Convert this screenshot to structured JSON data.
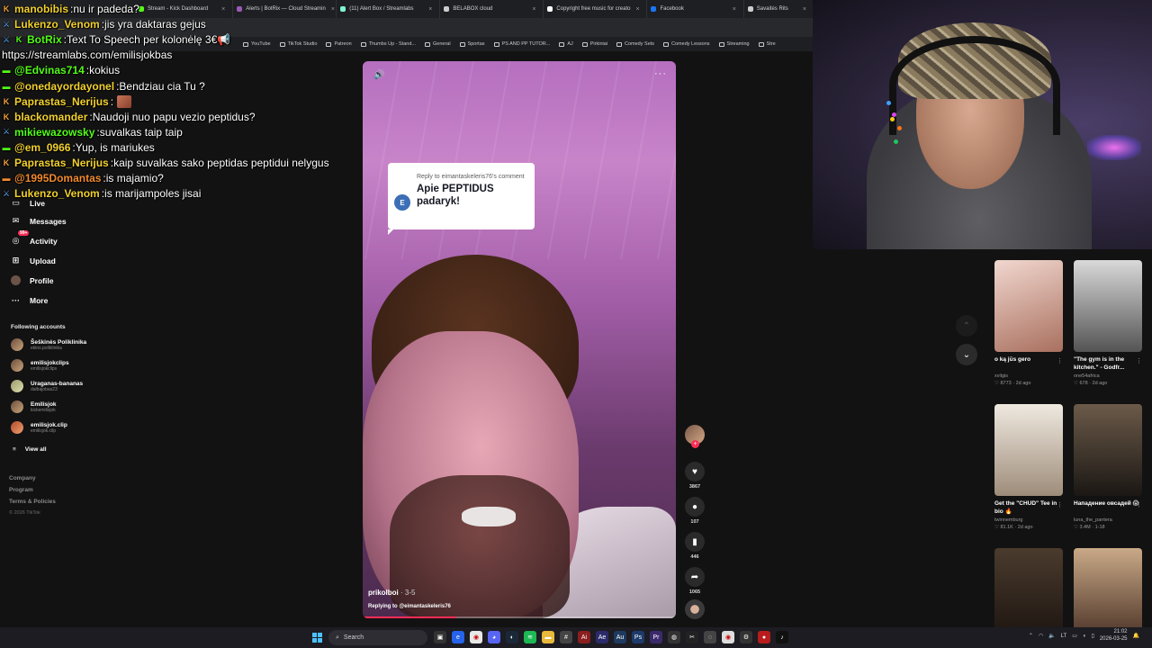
{
  "browser": {
    "tabs": [
      {
        "label": "Stream - Kick Dashboard",
        "color": "#53fc18"
      },
      {
        "label": "Alerts | BotRix — Cloud Streamin",
        "color": "#9b59b6"
      },
      {
        "label": "(11) Alert Box / Streamlabs",
        "color": "#80f5d2"
      },
      {
        "label": "BELABOX cloud",
        "color": "#cccccc"
      },
      {
        "label": "Copyright free music for creato",
        "color": "#ffffff"
      },
      {
        "label": "Facebook",
        "color": "#1877f2"
      },
      {
        "label": "Savaitės Rits",
        "color": "#cccccc"
      }
    ],
    "bookmarks": [
      "YouTube",
      "TikTok Studio",
      "Patreon",
      "Thumbs Up - Stand...",
      "General",
      "Sportas",
      "PS AND PP TUTOR...",
      "AJ",
      "Pirkiniai",
      "Comedy Sets",
      "Comedy Lessons",
      "Streaming",
      "Stre"
    ]
  },
  "chat": [
    {
      "badge": "kick",
      "user": "manobibis",
      "user_color": "#f2d12e",
      "message": "nu ir padeda?"
    },
    {
      "badge": "mod",
      "user": "Lukenzo_Venom",
      "user_color": "#f2d12e",
      "message": "jis yra daktaras gejus"
    },
    {
      "badge": "mod-kick",
      "user": "BotRix",
      "user_color": "#53fc18",
      "message": "Text To Speech per kolonėlę 3€",
      "emote": "megaphone"
    },
    {
      "badge": "",
      "user": "",
      "user_color": "#ffffff",
      "message": "https://streamlabs.com/emilisjokbas"
    },
    {
      "badge": "sub",
      "user": "@Edvinas714",
      "user_color": "#53fc18",
      "message": "kokius"
    },
    {
      "badge": "sub",
      "user": "@onedayordayonel",
      "user_color": "#f2d12e",
      "message": "Bendziau cia Tu ?"
    },
    {
      "badge": "kick",
      "user": "Paprastas_Nerijus",
      "user_color": "#f2d12e",
      "message": "",
      "emote": "face"
    },
    {
      "badge": "kick",
      "user": "blackomander",
      "user_color": "#f2d12e",
      "message": "Naudoji nuo papu vezio peptidus?"
    },
    {
      "badge": "mod",
      "user": "mikiewazowsky",
      "user_color": "#53fc18",
      "message": "suvalkas taip taip"
    },
    {
      "badge": "sub",
      "user": "@em_0966",
      "user_color": "#f2d12e",
      "message": "Yup, is mariukes"
    },
    {
      "badge": "kick",
      "user": "Paprastas_Nerijus",
      "user_color": "#f2d12e",
      "message": "kaip suvalkas sako peptidas peptidui nelygus"
    },
    {
      "badge": "sub-orange",
      "user": "@1995Domantas",
      "user_color": "#f28a2e",
      "message": "is majamio?"
    },
    {
      "badge": "mod",
      "user": "Lukenzo_Venom",
      "user_color": "#f2d12e",
      "message": "is marijampoles jisai"
    }
  ],
  "sidebar": {
    "items": [
      {
        "label": "Live",
        "icon": "live-icon"
      },
      {
        "label": "Messages",
        "icon": "messages-icon"
      },
      {
        "label": "Activity",
        "icon": "activity-icon",
        "badge": "99+"
      },
      {
        "label": "Upload",
        "icon": "upload-icon"
      },
      {
        "label": "Profile",
        "icon": "profile-icon"
      },
      {
        "label": "More",
        "icon": "more-icon"
      }
    ],
    "following_title": "Following accounts",
    "following": [
      {
        "name": "Šeškinės Poliklinika",
        "handle": "ekins.poliklinika"
      },
      {
        "name": "emilisjokclips",
        "handle": "emilisjokclips"
      },
      {
        "name": "Uraganas-bananas",
        "handle": "dalbajobas23"
      },
      {
        "name": "Emilisjok",
        "handle": "kickemilisjok"
      },
      {
        "name": "emilisjok.clip",
        "handle": "emilisjok.clip"
      }
    ],
    "view_all": "View all",
    "footer": [
      "Company",
      "Program",
      "Terms & Policies"
    ],
    "copyright": "© 2026 TikTok"
  },
  "video": {
    "reply_label": "Reply to eimantaskeleris76's comment",
    "reply_avatar": "E",
    "reply_text": "Apie PEPTIDUS padaryk!",
    "author": "prikolboi",
    "date": "· 3-5",
    "replying": "Replying to @eimantaskeleris76",
    "progress_fraction": 0.3,
    "accent": "#fe2c55"
  },
  "actions": {
    "likes": "3867",
    "comments": "107",
    "saves": "446",
    "shares": "1065"
  },
  "related": [
    {
      "title": "o ką jūs gero",
      "user": "xvilgis",
      "stats": "♡ 8773 · 2d ago",
      "thumb": "linear-gradient(160deg,#f1d7cf,#a9705f)"
    },
    {
      "title": "\"The gym is in the kitchen.\" - Godfr...",
      "user": "one54africa",
      "stats": "♡ 678 · 2d ago",
      "thumb": "linear-gradient(180deg,#d9d9d9,#545454)"
    },
    {
      "title": "Get the \"CHUD\" Tee in bio 🔥",
      "user": "twinnemburg",
      "stats": "♡ 81.1K · 2d ago",
      "thumb": "linear-gradient(180deg,#efe9e0,#9e8c7a)"
    },
    {
      "title": "Нападение овсадей 😱",
      "user": "luna_the_pantera",
      "stats": "♡ 3.4M · 1-18",
      "thumb": "linear-gradient(180deg,#6b5a49,#1b1714)"
    },
    {
      "title": "",
      "user": "",
      "stats": "",
      "thumb": "linear-gradient(180deg,#4a3b2d,#1c1410)"
    },
    {
      "title": "",
      "user": "",
      "stats": "",
      "thumb": "linear-gradient(180deg,#c9a987,#4a3125)"
    }
  ],
  "taskbar": {
    "search_placeholder": "Search",
    "lang": "LT",
    "time": "21:02",
    "date": "2026-03-25"
  }
}
